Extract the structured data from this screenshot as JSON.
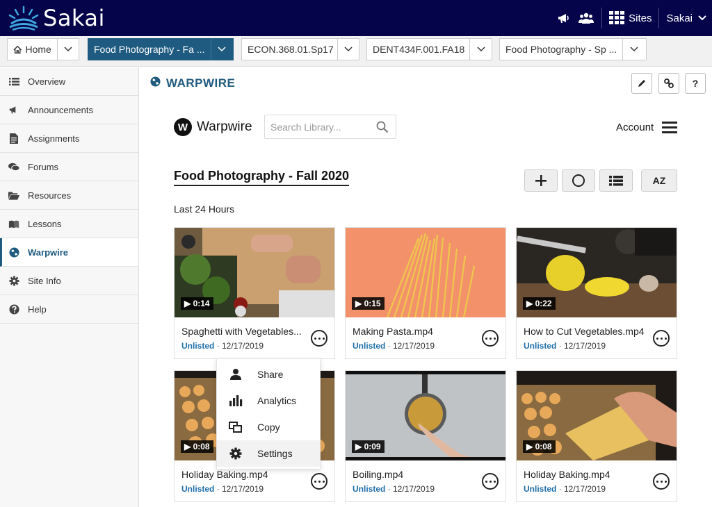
{
  "header": {
    "brand": "Sakai",
    "sites_label": "Sites",
    "user_label": "Sakai"
  },
  "tabs": [
    {
      "label": "Home"
    },
    {
      "label": "Food Photography - Fa ..."
    },
    {
      "label": "ECON.368.01.Sp17"
    },
    {
      "label": "DENT434F.001.FA18"
    },
    {
      "label": "Food Photography - Sp ..."
    }
  ],
  "sidebar": {
    "items": [
      {
        "label": "Overview",
        "icon": "list-icon"
      },
      {
        "label": "Announcements",
        "icon": "megaphone-icon"
      },
      {
        "label": "Assignments",
        "icon": "document-icon"
      },
      {
        "label": "Forums",
        "icon": "chat-icon"
      },
      {
        "label": "Resources",
        "icon": "folder-icon"
      },
      {
        "label": "Lessons",
        "icon": "book-icon"
      },
      {
        "label": "Warpwire",
        "icon": "globe-icon"
      },
      {
        "label": "Site Info",
        "icon": "gear-icon"
      },
      {
        "label": "Help",
        "icon": "question-icon"
      }
    ]
  },
  "tool": {
    "title": "WARPWIRE",
    "help_label": "?"
  },
  "warpwire": {
    "badge": "W",
    "brand": "Warpwire",
    "search_placeholder": "Search Library...",
    "account_label": "Account",
    "library_title": "Food Photography - Fall 2020",
    "section_label": "Last 24 Hours",
    "sort_label": "AZ"
  },
  "videos": [
    {
      "title": "Spaghetti with Vegetables...",
      "duration": "▶ 0:14",
      "status": "Unlisted",
      "date": " · 12/17/2019"
    },
    {
      "title": "Making Pasta.mp4",
      "duration": "▶ 0:15",
      "status": "Unlisted",
      "date": " · 12/17/2019"
    },
    {
      "title": "How to Cut Vegetables.mp4",
      "duration": "▶ 0:22",
      "status": "Unlisted",
      "date": " · 12/17/2019"
    },
    {
      "title": "Holiday Baking.mp4",
      "duration": "▶ 0:08",
      "status": "Unlisted",
      "date": " · 12/17/2019"
    },
    {
      "title": "Boiling.mp4",
      "duration": "▶ 0:09",
      "status": "Unlisted",
      "date": " · 12/17/2019"
    },
    {
      "title": "Holiday Baking.mp4",
      "duration": "▶ 0:08",
      "status": "Unlisted",
      "date": " · 12/17/2019"
    }
  ],
  "menu": {
    "items": [
      {
        "label": "Share",
        "icon": "person-icon"
      },
      {
        "label": "Analytics",
        "icon": "bar-chart-icon"
      },
      {
        "label": "Copy",
        "icon": "copy-icon"
      },
      {
        "label": "Settings",
        "icon": "gear-icon"
      }
    ]
  },
  "colors": {
    "topbar": "#05044a",
    "accent": "#1f5b80",
    "status": "#1f6fa8"
  }
}
